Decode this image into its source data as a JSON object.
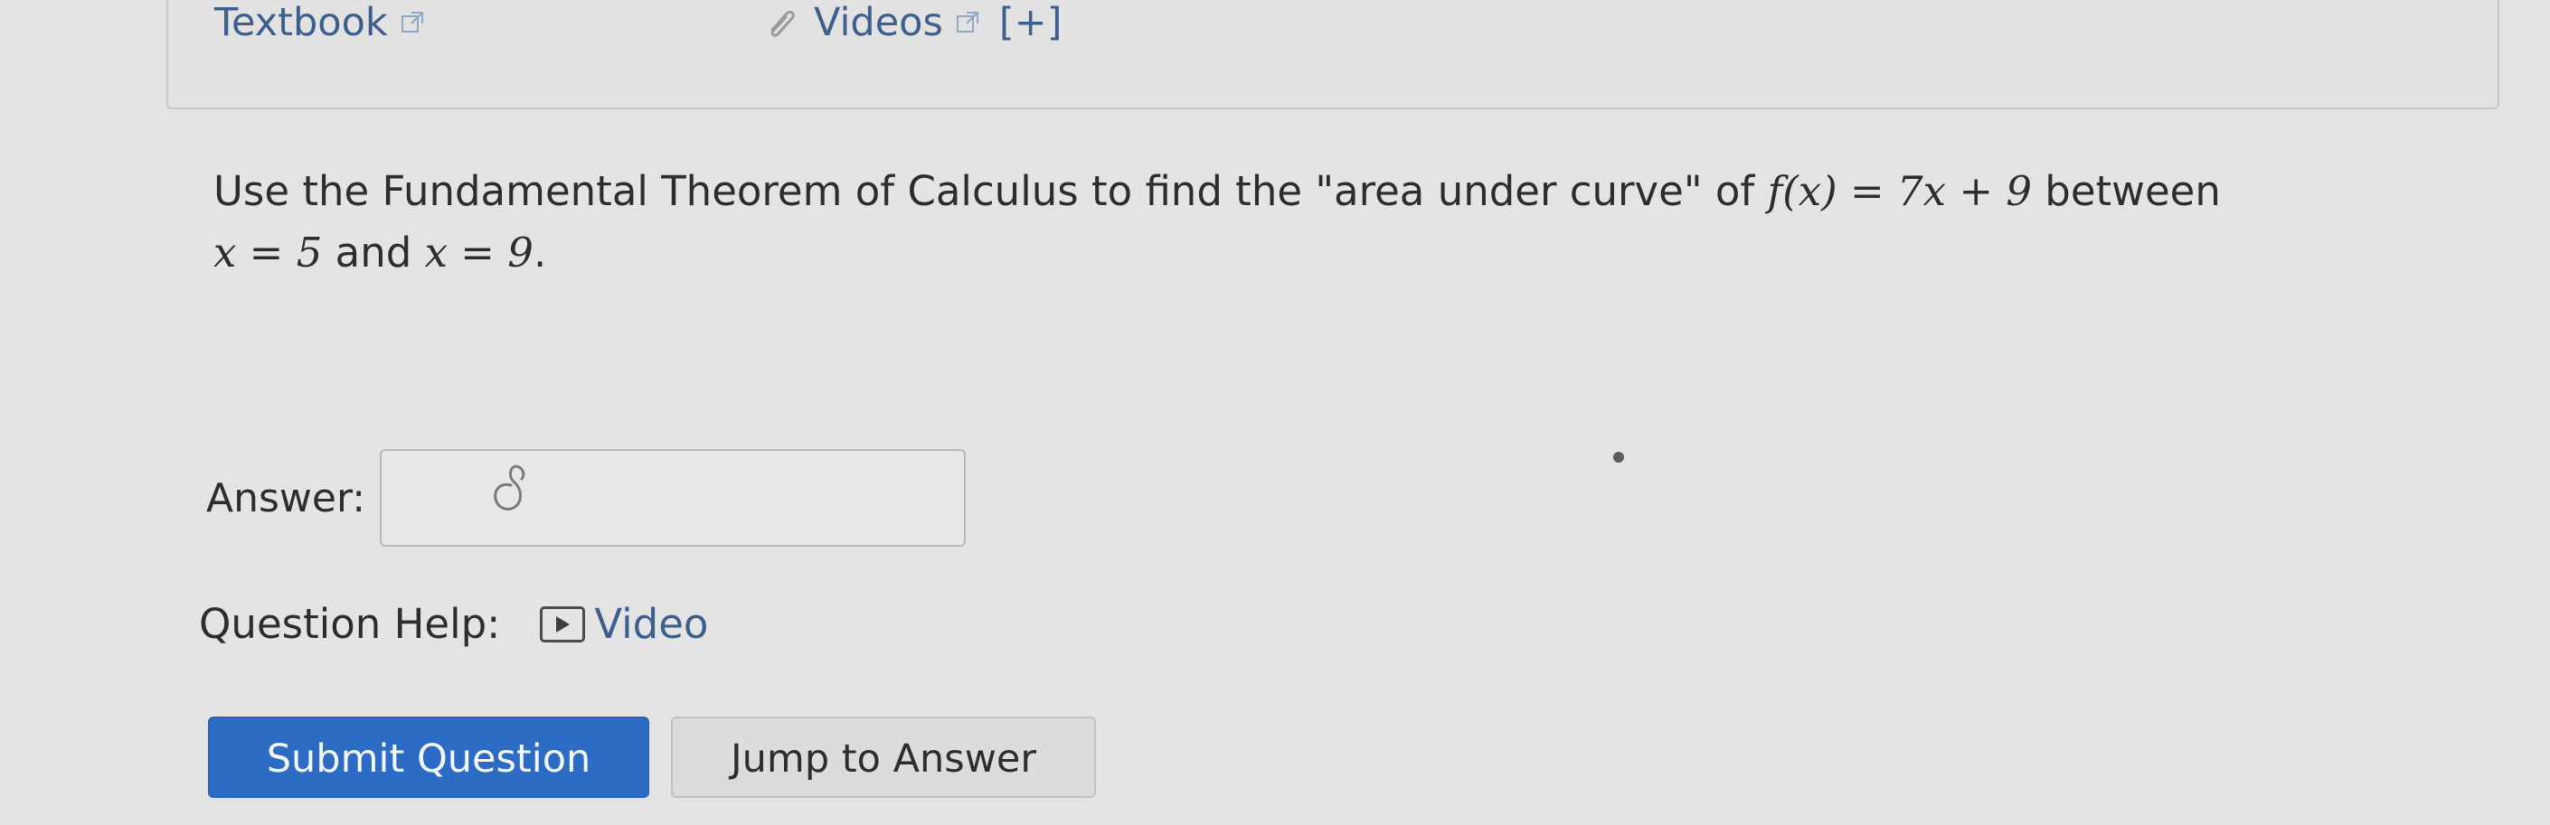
{
  "resources": {
    "textbook_label": "Textbook",
    "videos_label": "Videos",
    "expand_label": "[+]"
  },
  "question": {
    "text_part1": "Use the Fundamental Theorem of Calculus to find the \"area under curve\" of ",
    "math_f": "f(x) = 7x + 9",
    "text_part2": " between",
    "math_a": "x = 5",
    "text_and": " and ",
    "math_b": "x = 9",
    "text_end": "."
  },
  "answer": {
    "label": "Answer:",
    "value": ""
  },
  "help": {
    "label": "Question Help:",
    "video_label": "Video"
  },
  "buttons": {
    "submit_label": "Submit Question",
    "jump_label": "Jump to Answer"
  },
  "colors": {
    "link": "#3d5f8e",
    "primary_button": "#2d6cc4"
  },
  "icons": [
    "external-link-icon",
    "paperclip-icon",
    "play-icon",
    "text-cursor-icon"
  ]
}
